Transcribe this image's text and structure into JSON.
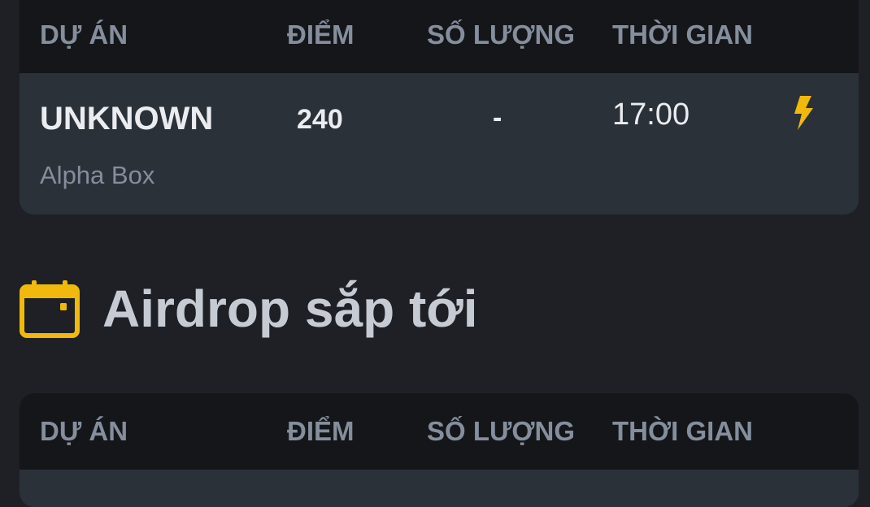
{
  "table_top": {
    "headers": [
      "DỰ ÁN",
      "ĐIỂM",
      "SỐ LƯỢNG",
      "THỜI GIAN"
    ],
    "rows": [
      {
        "project": "UNKNOWN",
        "subtitle": "Alpha Box",
        "points": "240",
        "amount": "-",
        "time": "17:00",
        "icon": "lightning-icon"
      }
    ]
  },
  "section": {
    "title": "Airdrop sắp tới",
    "icon": "calendar-icon"
  },
  "table_bottom": {
    "headers": [
      "DỰ ÁN",
      "ĐIỂM",
      "SỐ LƯỢNG",
      "THỜI GIAN"
    ]
  },
  "colors": {
    "background": "#1e2026",
    "card": "#2b3139",
    "header": "#15161a",
    "accent": "#f0b90b",
    "muted": "#848e9c"
  }
}
